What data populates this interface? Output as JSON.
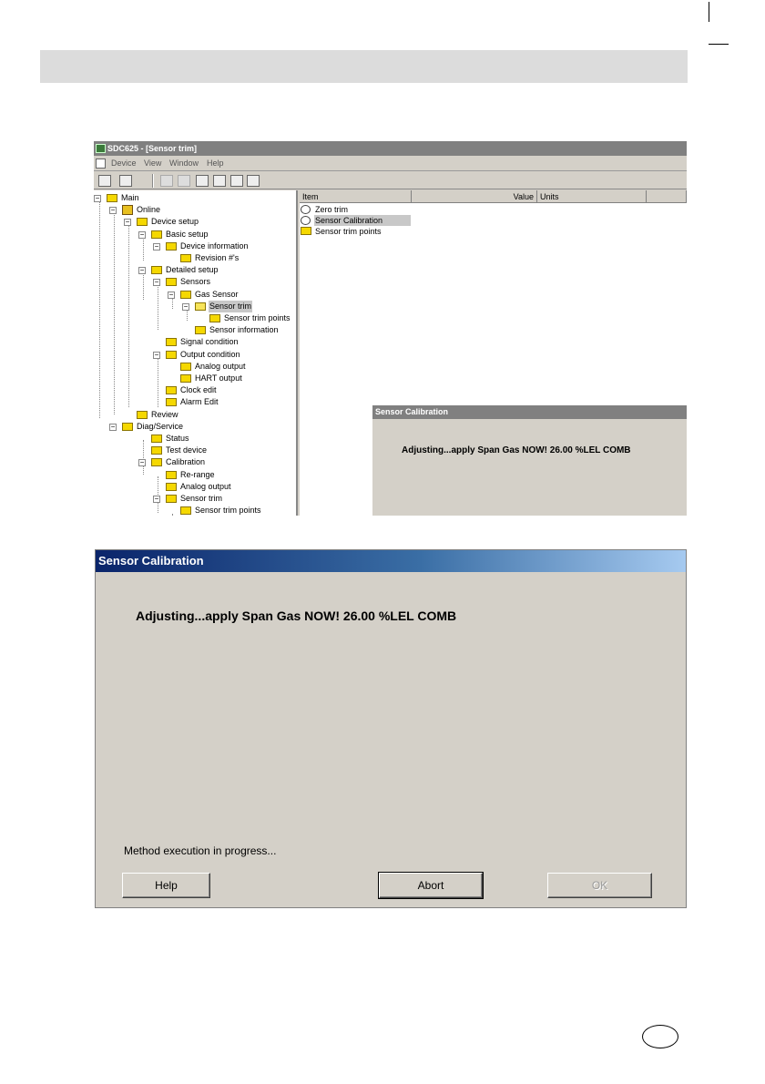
{
  "upper_screenshot": {
    "window_title": "SDC625 - [Sensor trim]",
    "menu": [
      "Device",
      "View",
      "Window",
      "Help"
    ],
    "tree": [
      {
        "label": "Main",
        "expander": "−"
      },
      {
        "label": "Online",
        "expander": "−"
      },
      {
        "label": "Device setup",
        "expander": "−"
      },
      {
        "label": "Basic setup",
        "expander": "−"
      },
      {
        "label": "Device information",
        "expander": "−"
      },
      {
        "label": "Revision #'s"
      },
      {
        "label": "Detailed setup",
        "expander": "−"
      },
      {
        "label": "Sensors",
        "expander": "−"
      },
      {
        "label": "Gas Sensor",
        "expander": "−"
      },
      {
        "label": "Sensor trim",
        "expander": "−",
        "selected": true
      },
      {
        "label": "Sensor trim points"
      },
      {
        "label": "Sensor information"
      },
      {
        "label": "Signal condition"
      },
      {
        "label": "Output condition",
        "expander": "−"
      },
      {
        "label": "Analog output"
      },
      {
        "label": "HART output"
      },
      {
        "label": "Clock edit"
      },
      {
        "label": "Alarm Edit"
      },
      {
        "label": "Review"
      },
      {
        "label": "Diag/Service",
        "expander": "−"
      },
      {
        "label": "Status"
      },
      {
        "label": "Test device"
      },
      {
        "label": "Calibration",
        "expander": "−"
      },
      {
        "label": "Re-range"
      },
      {
        "label": "Analog output"
      },
      {
        "label": "Sensor trim",
        "expander": "−"
      },
      {
        "label": "Sensor trim points"
      }
    ],
    "columns": [
      "Item",
      "Value",
      "Units"
    ],
    "list_items": [
      {
        "label": "Zero trim",
        "icon": "method-icon"
      },
      {
        "label": "Sensor Calibration",
        "icon": "method-icon",
        "selected": true
      },
      {
        "label": "Sensor trim points",
        "icon": "folder-icon"
      }
    ],
    "mini_dialog": {
      "title": "Sensor Calibration",
      "message": "Adjusting...apply Span Gas NOW!  26.00 %LEL  COMB"
    }
  },
  "dialog": {
    "title": "Sensor Calibration",
    "message": "Adjusting...apply Span Gas NOW!  26.00 %LEL  COMB",
    "status": "Method execution in progress...",
    "buttons": {
      "help": "Help",
      "abort": "Abort",
      "ok": "OK"
    },
    "title_gradient": [
      "#0a246a",
      "#a6caf0"
    ]
  }
}
